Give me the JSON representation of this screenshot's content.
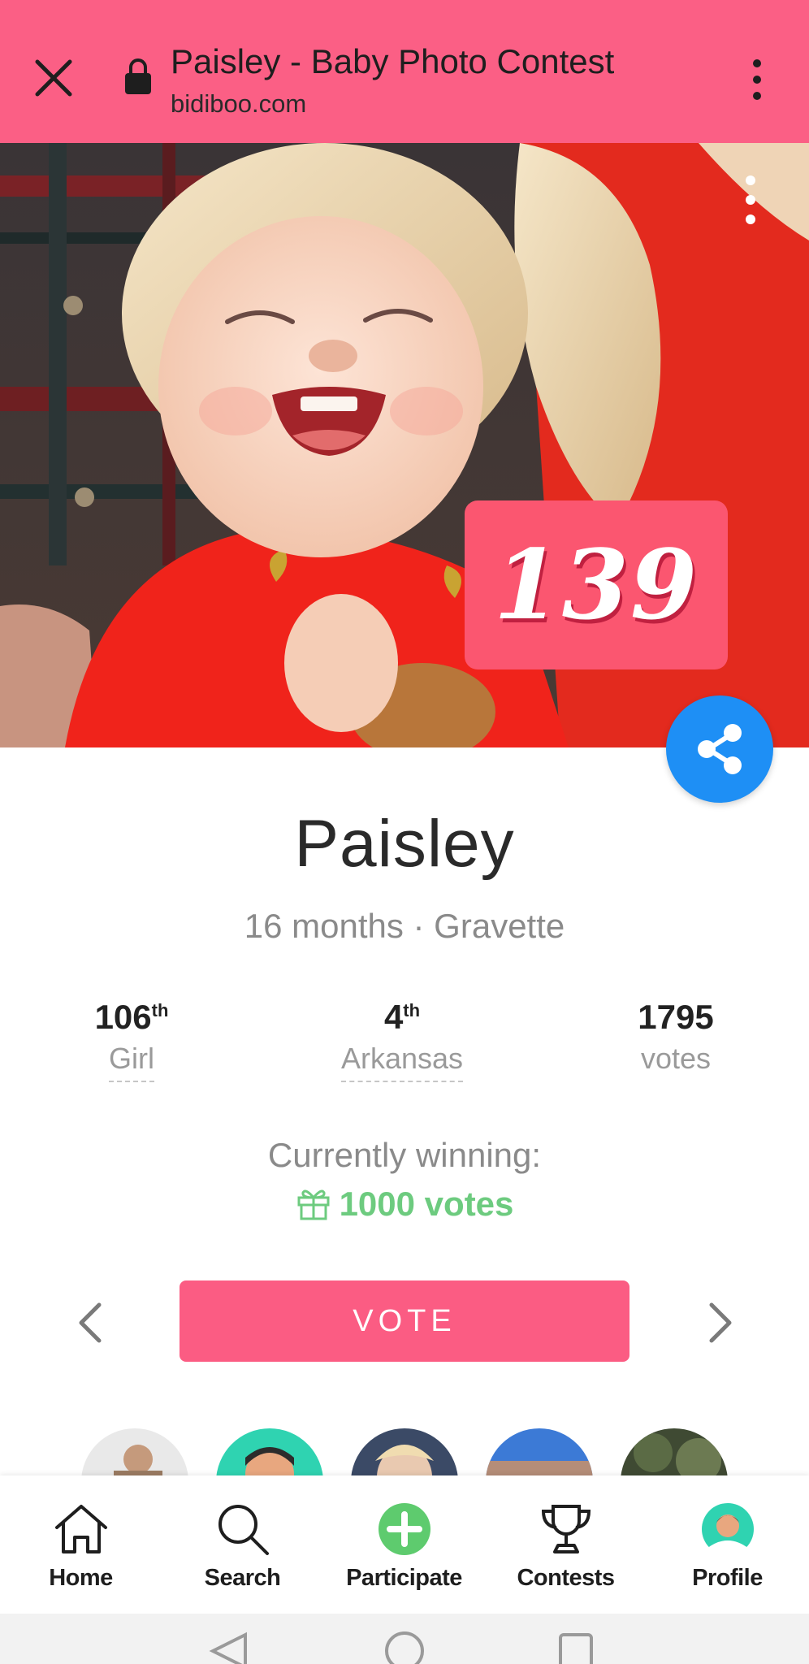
{
  "browser": {
    "title": "Paisley - Baby Photo Contest",
    "url": "bidiboo.com",
    "icons": {
      "close": "close-icon",
      "lock": "lock-icon",
      "menu": "more-vert-icon"
    }
  },
  "photo": {
    "rank_badge": "139",
    "menu_icon": "more-vert-icon",
    "share_icon": "share-icon",
    "colors": {
      "badge": "#fb5670",
      "share": "#1e8ff5"
    }
  },
  "profile": {
    "name": "Paisley",
    "subline": "16 months · Gravette"
  },
  "stats": {
    "girl": {
      "rank": "106",
      "suffix": "th",
      "label": "Girl"
    },
    "state": {
      "rank": "4",
      "suffix": "th",
      "label": "Arkansas"
    },
    "votes": {
      "value": "1795",
      "label": "votes"
    }
  },
  "winning": {
    "label": "Currently winning:",
    "value": "1000 votes",
    "icon": "gift-icon",
    "color": "#6dcb7f"
  },
  "actions": {
    "vote_label": "VOTE",
    "prev_icon": "chevron-left-icon",
    "next_icon": "chevron-right-icon",
    "accent": "#fb5c83"
  },
  "bottom_nav": [
    {
      "label": "Home",
      "icon": "home-icon"
    },
    {
      "label": "Search",
      "icon": "search-icon"
    },
    {
      "label": "Participate",
      "icon": "add-circle-icon"
    },
    {
      "label": "Contests",
      "icon": "trophy-icon"
    },
    {
      "label": "Profile",
      "icon": "avatar-icon"
    }
  ]
}
